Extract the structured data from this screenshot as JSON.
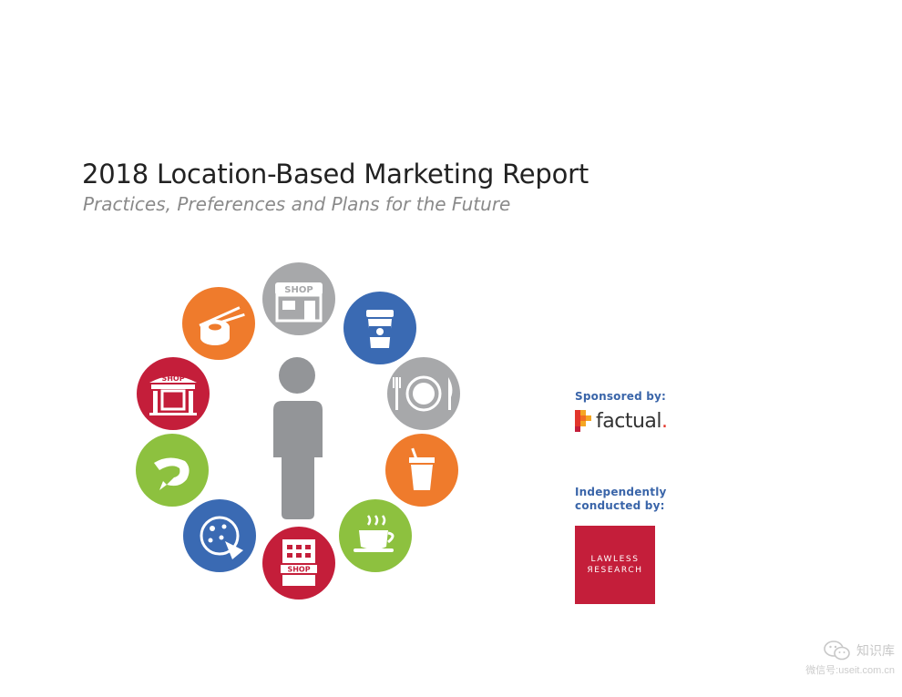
{
  "report": {
    "title": "2018 Location-Based Marketing Report",
    "subtitle": "Practices, Preferences and Plans for the Future"
  },
  "illustration": {
    "icons": [
      {
        "name": "shop-storefront-icon",
        "color": "#a7a8aa",
        "sign": "SHOP"
      },
      {
        "name": "coffee-cup-icon",
        "color": "#3a6ab3"
      },
      {
        "name": "plate-fork-knife-icon",
        "color": "#a7a8aa"
      },
      {
        "name": "soda-cup-straw-icon",
        "color": "#ef7b2c"
      },
      {
        "name": "hot-tea-cup-icon",
        "color": "#8dc13f"
      },
      {
        "name": "shop-building-icon",
        "color": "#c41e3a",
        "sign": "SHOP"
      },
      {
        "name": "pizza-icon",
        "color": "#3a6ab3"
      },
      {
        "name": "shrimp-icon",
        "color": "#8dc13f"
      },
      {
        "name": "shop-awning-icon",
        "color": "#c41e3a",
        "sign": "SHOP"
      },
      {
        "name": "sushi-chopsticks-icon",
        "color": "#ef7b2c"
      }
    ],
    "person_color": "#939598"
  },
  "sponsor": {
    "label": "Sponsored by:",
    "brand": "factual",
    "brand_suffix": "."
  },
  "conductor": {
    "label": "Independently conducted by:",
    "brand_line1": "LAWLESS",
    "brand_line2": "ЯESEARCH",
    "color": "#c41e3a"
  },
  "watermark": {
    "name": "知识库",
    "account": "微信号:useit.com.cn"
  }
}
